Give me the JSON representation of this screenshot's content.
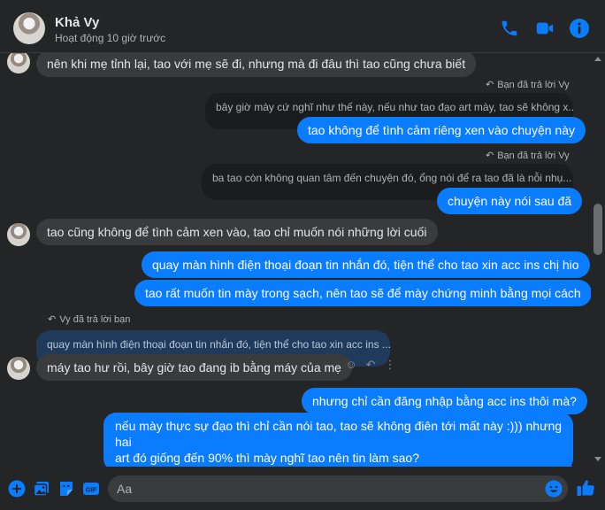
{
  "header": {
    "contact_name": "Khả Vy",
    "status": "Hoạt động 10 giờ trước"
  },
  "messages": [
    {
      "direction": "in",
      "text": "nên khi mẹ tỉnh lại, tao với mẹ sẽ đi, nhưng mà đi đâu thì tao cũng chưa biết"
    },
    {
      "direction": "out",
      "reply_note": "Bạn đã trả lời Vy",
      "quoted": "bây giờ mày cứ nghĩ như thế này, nếu như tao đạo art mày, tao sẽ không x...",
      "text": "tao không để tình cảm riêng xen vào chuyện này"
    },
    {
      "direction": "out",
      "reply_note": "Bạn đã trả lời Vy",
      "quoted": "ba tao còn không quan tâm đến chuyện đó, ổng nói để ra tao đã là nỗi nhụ...",
      "text": "chuyện này nói sau đã"
    },
    {
      "direction": "in",
      "text": "tao cũng không để tình cảm xen vào, tao chỉ muốn nói những lời cuối"
    },
    {
      "direction": "out",
      "text": "quay màn hình điện thoại đoạn tin nhắn đó, tiện thể cho tao xin acc ins chị hio"
    },
    {
      "direction": "out",
      "text": "tao rất muốn tin mày trong sạch, nên tao sẽ để mày chứng minh bằng mọi cách"
    },
    {
      "direction": "in",
      "reply_note": "Vy đã trả lời bạn",
      "quoted": "quay màn hình điện thoại đoạn tin nhắn đó, tiện thể cho tao xin acc ins ...",
      "text": "máy tao hư rồi, bây giờ tao đang ib bằng máy của mẹ"
    },
    {
      "direction": "out",
      "text": "nhưng chỉ cần đăng nhập bằng acc ins thôi mà?"
    },
    {
      "direction": "out",
      "text_line1": "nếu mày thực sự đạo thì chỉ cần nói tao, tao sẽ không điên tới mất này :))) nhưng hai",
      "text_line2": "art đó giống đến 90% thì mày nghĩ tao nên tin làm sao?"
    }
  ],
  "composer": {
    "placeholder": "Aa"
  },
  "icons": {
    "header": [
      "phone-icon",
      "video-call-icon",
      "info-icon"
    ],
    "footer": [
      "plus-icon",
      "image-icon",
      "sticker-icon",
      "gif-icon",
      "emoji-icon",
      "like-icon"
    ],
    "gif_label": "GIF"
  },
  "colors": {
    "accent": "#0a7cff",
    "background": "#242526",
    "incoming_bubble": "#3a3b3c"
  }
}
